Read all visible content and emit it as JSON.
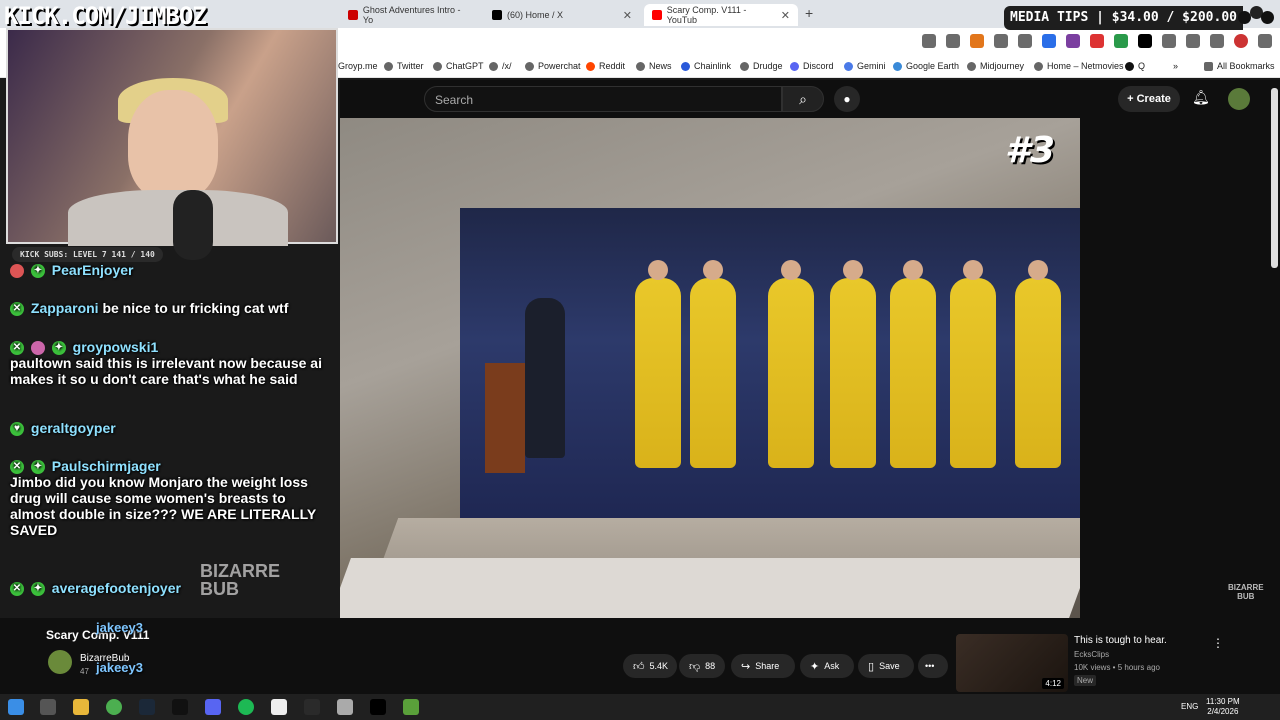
{
  "overlay": {
    "banner": "KICK.COM/JIMBOZ",
    "kick_subs": "KICK SUBS: LEVEL 7 141 / 140",
    "media_tips": "MEDIA TIPS | $34.00 / $200.00"
  },
  "browser": {
    "tabs": [
      {
        "label": "Ghost Adventures Intro - Yo",
        "color": "#cc0000"
      },
      {
        "label": "(60) Home / X",
        "color": "#000000"
      },
      {
        "label": "Scary Comp. V111 - YouTub",
        "color": "#ff0000"
      }
    ],
    "new_tab": "+",
    "bookmarks": [
      {
        "label": "Groyp.me"
      },
      {
        "label": "Twitter"
      },
      {
        "label": "ChatGPT"
      },
      {
        "label": "/x/"
      },
      {
        "label": "Powerchat"
      },
      {
        "label": "Reddit"
      },
      {
        "label": "News"
      },
      {
        "label": "Chainlink"
      },
      {
        "label": "Drudge"
      },
      {
        "label": "Discord"
      },
      {
        "label": "Gemini"
      },
      {
        "label": "Google Earth"
      },
      {
        "label": "Midjourney"
      },
      {
        "label": "Home – Netmovies"
      },
      {
        "label": "Q"
      }
    ],
    "bookmarks_more": "»",
    "all_bookmarks": "All Bookmarks"
  },
  "youtube": {
    "search_placeholder": "Search",
    "create_label": "Create",
    "video_badge": "#3",
    "watermark": "BIZARRE\nBUB",
    "title": "Scary Comp. V111",
    "channel": "BizarreBub",
    "subscribers": "47",
    "actions": {
      "like": "5.4K",
      "dislike": "88",
      "share": "Share",
      "ask": "Ask",
      "save": "Save",
      "more": "•••"
    },
    "recommended": {
      "title": "This is tough to hear.",
      "channel": "EcksClips",
      "meta": "10K views • 5 hours ago",
      "badge": "New",
      "duration": "4:12"
    }
  },
  "chat": [
    {
      "user": "PearEnjoyer",
      "text": "",
      "color": "#8fe1ff"
    },
    {
      "user": "Zapparoni",
      "text": "be nice to ur fricking cat wtf",
      "color": "#8fe1ff"
    },
    {
      "user": "groypowski1",
      "text": "paultown said this is irrelevant now because ai makes it so u don't care that's what he said",
      "color": "#8fe1ff"
    },
    {
      "user": "geraltgoyper",
      "text": "",
      "color": "#8fe1ff"
    },
    {
      "user": "Paulschirmjager",
      "text": "Jimbo did you know Monjaro the weight loss drug will cause some women's breasts to almost double in size??? WE ARE LITERALLY SAVED",
      "color": "#8fe1ff"
    },
    {
      "user": "averagefootenjoyer",
      "text": "",
      "color": "#8fe1ff"
    }
  ],
  "bottom_chat": [
    {
      "user": "jakeey3"
    },
    {
      "user": "jakeey3"
    }
  ],
  "bizarre_logo": "BIZARRE\nBUB",
  "taskbar": {
    "lang": "ENG",
    "time": "11:30 PM",
    "date": "2/4/2026"
  }
}
